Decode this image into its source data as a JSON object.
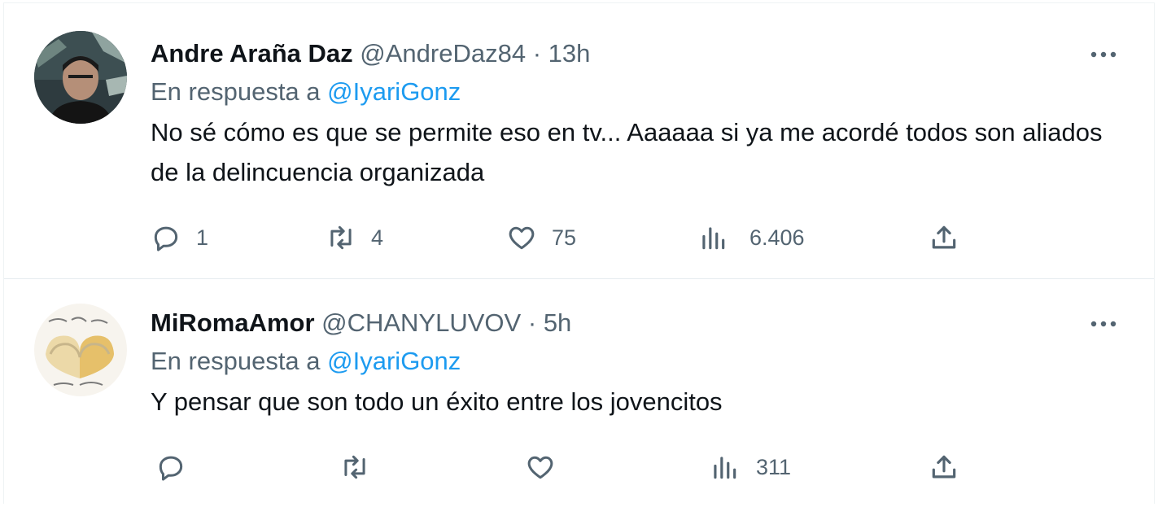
{
  "tweets": [
    {
      "name": "Andre Araña Daz",
      "handle": "@AndreDaz84",
      "separator": "·",
      "time": "13h",
      "reply_prefix": "En respuesta a",
      "reply_to": "@IyariGonz",
      "text": "No sé cómo es que se permite eso en tv... Aaaaaa si ya me acordé todos son aliados de la delincuencia organizada",
      "replies": "1",
      "retweets": "4",
      "likes": "75",
      "views": "6.406"
    },
    {
      "name": "MiRomaAmor",
      "handle": "@CHANYLUVOV",
      "separator": "·",
      "time": "5h",
      "reply_prefix": "En respuesta a",
      "reply_to": "@IyariGonz",
      "text": "Y pensar que son todo un éxito entre los jovencitos",
      "replies": "",
      "retweets": "",
      "likes": "",
      "views": "311"
    }
  ],
  "icons": {
    "reply": "reply-icon",
    "retweet": "retweet-icon",
    "like": "like-icon",
    "views": "views-icon",
    "share": "share-icon",
    "more": "more-icon"
  },
  "colors": {
    "text": "#0f1419",
    "muted": "#536471",
    "link": "#1d9bf0",
    "border": "#e6ecf0"
  }
}
